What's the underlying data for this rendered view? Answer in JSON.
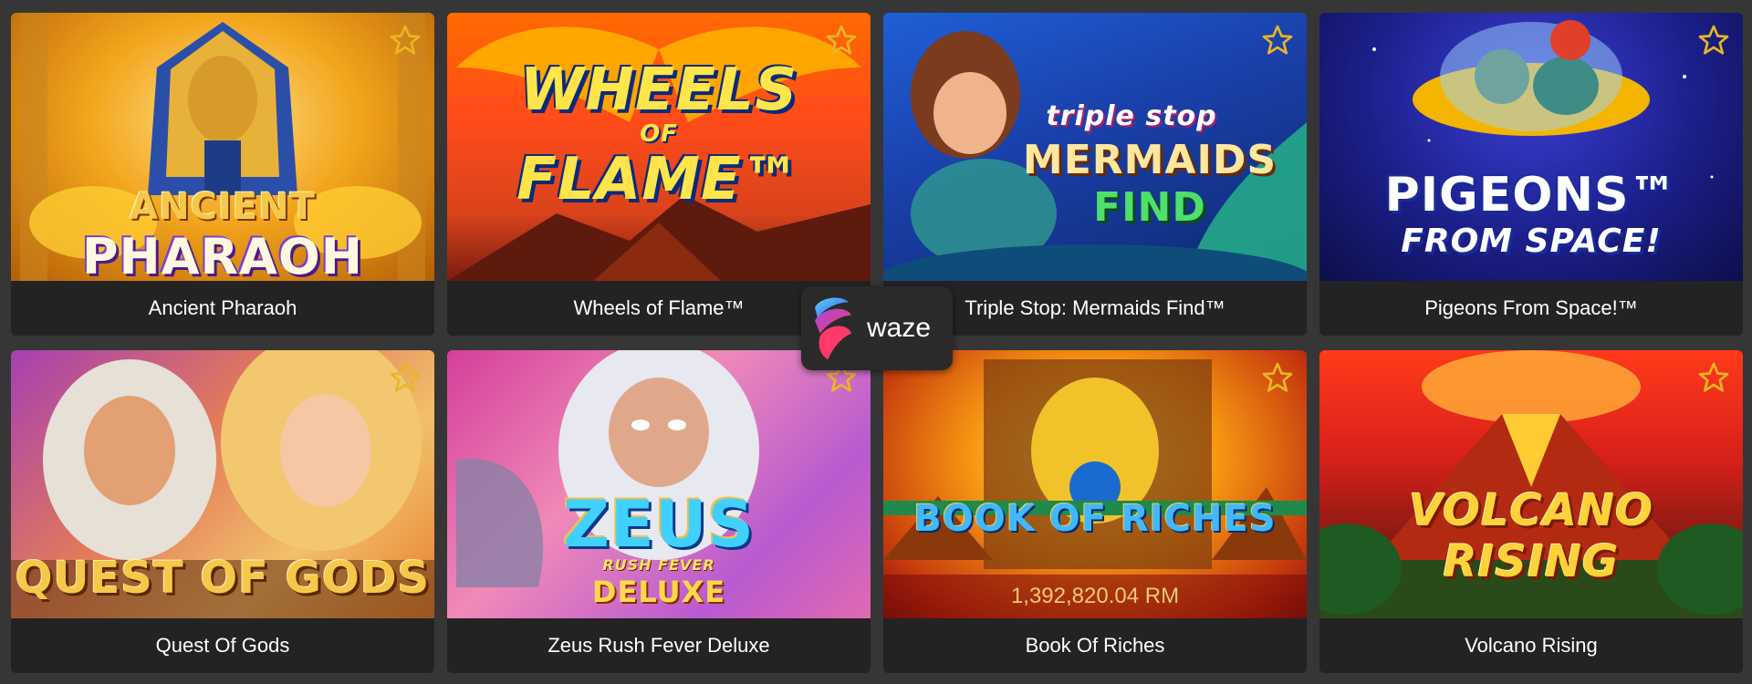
{
  "games": [
    {
      "title": "Ancient Pharaoh",
      "logo_top": "ANCIENT",
      "logo_bottom": "PHARAOH",
      "favorite_icon": "star-outline-icon"
    },
    {
      "title": "Wheels of Flame™",
      "logo_top": "WHEELS",
      "logo_mid": "OF",
      "logo_bottom": "FLAME™",
      "favorite_icon": "star-outline-icon"
    },
    {
      "title": "Triple Stop: Mermaids Find™",
      "logo_top": "triple stop",
      "logo_mid": "MERMAIDS",
      "logo_bottom": "FIND",
      "favorite_icon": "star-outline-icon"
    },
    {
      "title": "Pigeons From Space!™",
      "logo_top": "PIGEONS™",
      "logo_bottom": "FROM SPACE!",
      "favorite_icon": "star-outline-icon"
    },
    {
      "title": "Quest Of Gods",
      "logo_top": "QUEST OF GODS",
      "favorite_icon": "star-outline-icon"
    },
    {
      "title": "Zeus Rush Fever Deluxe",
      "logo_top": "ZEUS",
      "logo_mid": "RUSH FEVER",
      "logo_bottom": "DELUXE",
      "favorite_icon": "star-outline-icon"
    },
    {
      "title": "Book Of Riches",
      "logo_top": "BOOK OF RICHES",
      "jackpot": "1,392,820.04 RM",
      "favorite_icon": "star-outline-icon"
    },
    {
      "title": "Volcano Rising",
      "logo_top": "VOLCANO RISING",
      "favorite_icon": "star-outline-icon"
    }
  ],
  "overlay": {
    "label": "waze",
    "icon": "waze-app-logo-icon"
  },
  "colors": {
    "page_bg": "#363636",
    "card_caption_bg": "#232323",
    "star": "#e9b623",
    "jackpot_text": "#f3c873"
  }
}
